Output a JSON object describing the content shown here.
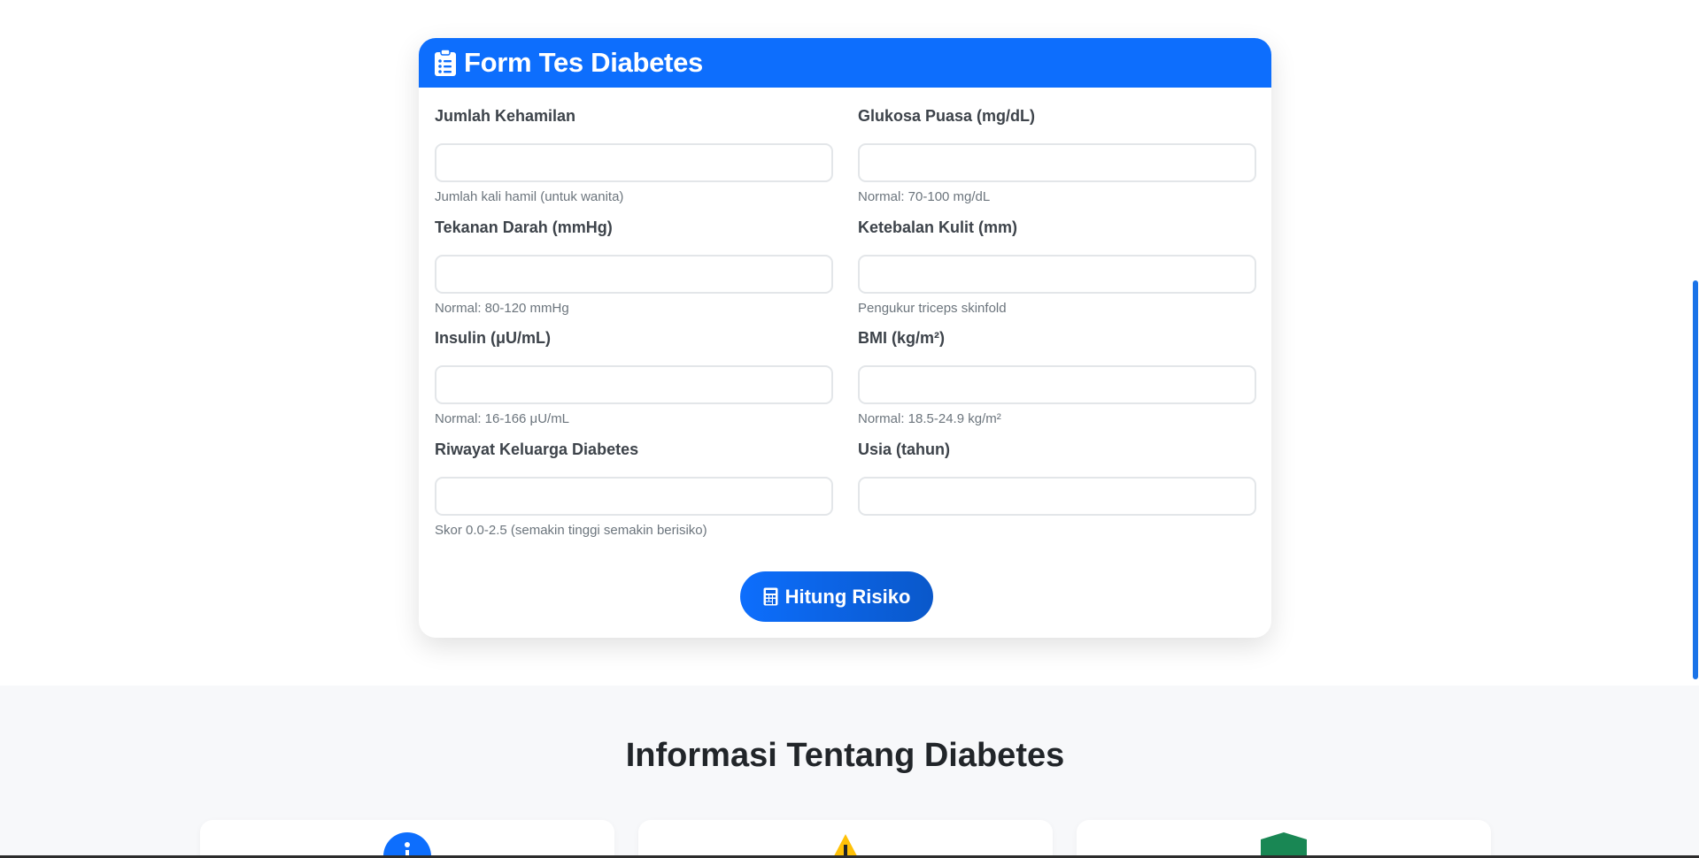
{
  "form": {
    "title": "Form Tes Diabetes",
    "fields": [
      {
        "label": "Jumlah Kehamilan",
        "value": "",
        "hint": "Jumlah kali hamil (untuk wanita)"
      },
      {
        "label": "Glukosa Puasa (mg/dL)",
        "value": "",
        "hint": "Normal: 70-100 mg/dL"
      },
      {
        "label": "Tekanan Darah (mmHg)",
        "value": "",
        "hint": "Normal: 80-120 mmHg"
      },
      {
        "label": "Ketebalan Kulit (mm)",
        "value": "",
        "hint": "Pengukur triceps skinfold"
      },
      {
        "label": "Insulin (μU/mL)",
        "value": "",
        "hint": "Normal: 16-166 μU/mL"
      },
      {
        "label": "BMI (kg/m²)",
        "value": "",
        "hint": "Normal: 18.5-24.9 kg/m²"
      },
      {
        "label": "Riwayat Keluarga Diabetes",
        "value": "",
        "hint": "Skor 0.0-2.5 (semakin tinggi semakin berisiko)"
      },
      {
        "label": "Usia (tahun)",
        "value": ""
      }
    ],
    "submit_label": "Hitung Risiko"
  },
  "info": {
    "heading": "Informasi Tentang Diabetes",
    "cards": [
      {
        "icon": "info-icon"
      },
      {
        "icon": "warning-icon"
      },
      {
        "icon": "shield-icon"
      }
    ]
  },
  "colors": {
    "primary": "#0d6efd",
    "warning": "#ffc107",
    "success": "#198754"
  }
}
